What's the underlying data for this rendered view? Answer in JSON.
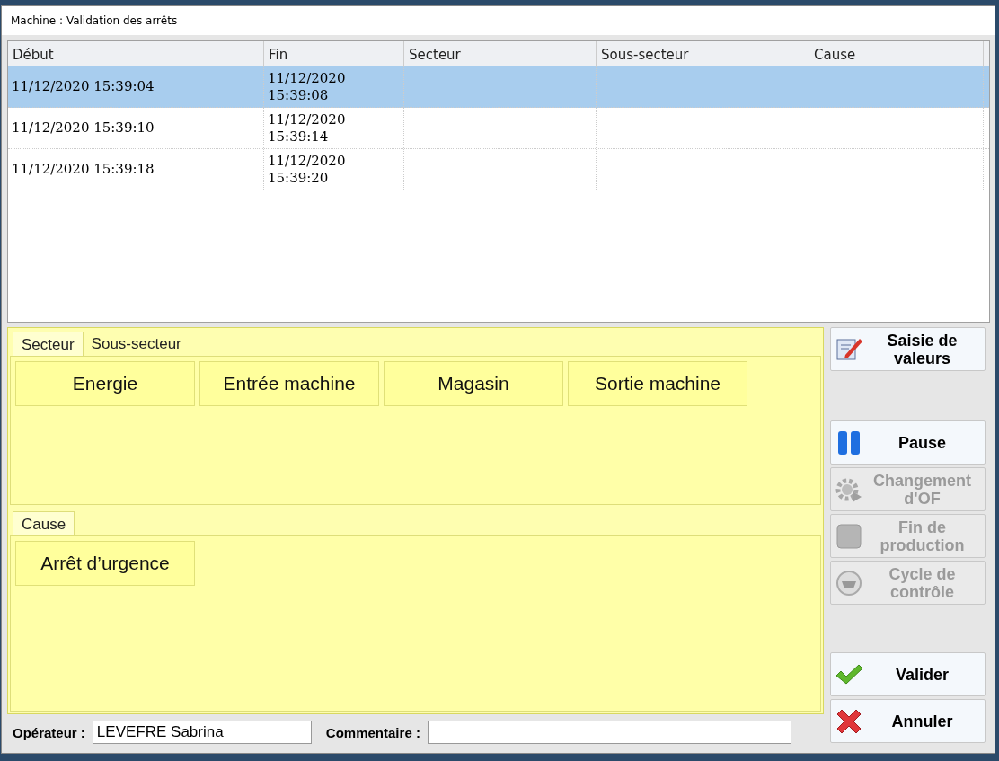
{
  "window": {
    "title": "Machine : Validation des arrêts"
  },
  "table": {
    "columns": [
      "Début",
      "Fin",
      "Secteur",
      "Sous-secteur",
      "Cause"
    ],
    "rows": [
      {
        "selected": true,
        "cells": [
          "11/12/2020 15:39:04",
          "11/12/2020\n15:39:08",
          "",
          "",
          ""
        ]
      },
      {
        "selected": false,
        "cells": [
          "11/12/2020 15:39:10",
          "11/12/2020\n15:39:14",
          "",
          "",
          ""
        ]
      },
      {
        "selected": false,
        "cells": [
          "11/12/2020 15:39:18",
          "11/12/2020\n15:39:20",
          "",
          "",
          ""
        ]
      }
    ]
  },
  "sector_panel": {
    "tabs": [
      {
        "label": "Secteur",
        "selected": true
      },
      {
        "label": "Sous-secteur",
        "selected": false
      }
    ],
    "choices": [
      "Energie",
      "Entrée machine",
      "Magasin",
      "Sortie machine"
    ]
  },
  "cause_panel": {
    "tabs": [
      {
        "label": "Cause",
        "selected": true
      }
    ],
    "choices": [
      "Arrêt d’urgence"
    ]
  },
  "side_groups": [
    {
      "buttons": [
        {
          "kind": "edit",
          "label": "Saisie de\nvaleurs",
          "disabled": false
        }
      ]
    },
    {
      "buttons": [
        {
          "kind": "pause",
          "label": "Pause",
          "disabled": false
        },
        {
          "kind": "gear",
          "label": "Changement\nd'OF",
          "disabled": true
        },
        {
          "kind": "stop",
          "label": "Fin de\nproduction",
          "disabled": true
        },
        {
          "kind": "cycle",
          "label": "Cycle de\ncontrôle",
          "disabled": true
        }
      ]
    },
    {
      "buttons": [
        {
          "kind": "check",
          "label": "Valider",
          "disabled": false
        },
        {
          "kind": "cross",
          "label": "Annuler",
          "disabled": false
        }
      ]
    }
  ],
  "footer": {
    "operator_label": "Opérateur :",
    "operator_value": "LEVEFRE Sabrina",
    "comment_label": "Commentaire :"
  }
}
